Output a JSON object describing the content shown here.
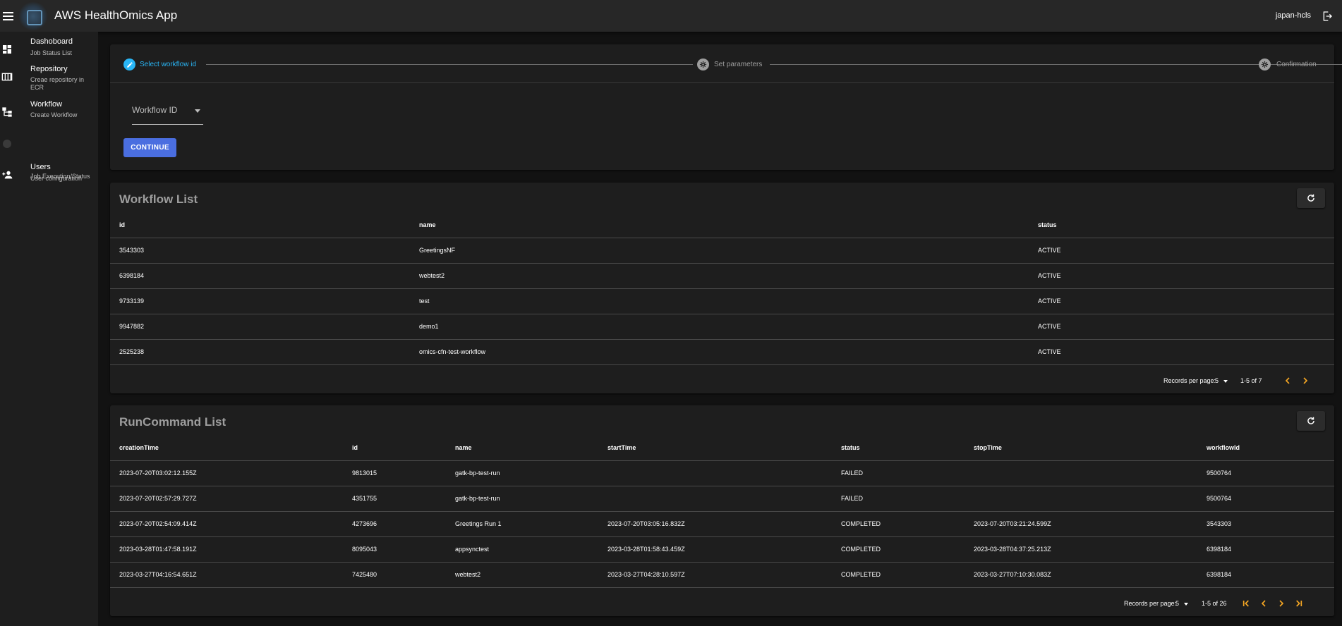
{
  "header": {
    "title": "AWS HealthOmics App",
    "user": "japan-hcls"
  },
  "sidebar": {
    "items": [
      {
        "title": "Dashoboard",
        "subtitle": "Job Status List"
      },
      {
        "title": "Repository",
        "subtitle": "Creae repository in ECR"
      },
      {
        "title": "Workflow",
        "subtitle": "Create Workflow"
      },
      {
        "title": "",
        "subtitle": "Job Execution/Status"
      },
      {
        "title": "Users",
        "subtitle": "User configuration"
      }
    ]
  },
  "stepper": {
    "steps": [
      {
        "label": "Select workflow id",
        "active": true
      },
      {
        "label": "Set parameters",
        "active": false
      },
      {
        "label": "Confirmation",
        "active": false
      }
    ],
    "active_color": "#29b6f6",
    "workflow_select_label": "Workflow ID",
    "continue_label": "CONTINUE"
  },
  "workflow_list": {
    "title": "Workflow List",
    "columns": [
      "id",
      "name",
      "status"
    ],
    "rows": [
      [
        "3543303",
        "GreetingsNF",
        "ACTIVE"
      ],
      [
        "6398184",
        "webtest2",
        "ACTIVE"
      ],
      [
        "9733139",
        "test",
        "ACTIVE"
      ],
      [
        "9947882",
        "demo1",
        "ACTIVE"
      ],
      [
        "2525238",
        "omics-cfn-test-workflow",
        "ACTIVE"
      ]
    ],
    "pagination": {
      "records_label": "Records per page:",
      "per_page": "5",
      "range": "1-5 of 7"
    }
  },
  "run_list": {
    "title": "RunCommand List",
    "columns": [
      "creationTime",
      "id",
      "name",
      "startTime",
      "status",
      "stopTime",
      "workflowId"
    ],
    "rows": [
      [
        "2023-07-20T03:02:12.155Z",
        "9813015",
        "gatk-bp-test-run",
        "",
        "FAILED",
        "",
        "9500764"
      ],
      [
        "2023-07-20T02:57:29.727Z",
        "4351755",
        "gatk-bp-test-run",
        "",
        "FAILED",
        "",
        "9500764"
      ],
      [
        "2023-07-20T02:54:09.414Z",
        "4273696",
        "Greetings Run 1",
        "2023-07-20T03:05:16.832Z",
        "COMPLETED",
        "2023-07-20T03:21:24.599Z",
        "3543303"
      ],
      [
        "2023-03-28T01:47:58.191Z",
        "8095043",
        "appsynctest",
        "2023-03-28T01:58:43.459Z",
        "COMPLETED",
        "2023-03-28T04:37:25.213Z",
        "6398184"
      ],
      [
        "2023-03-27T04:16:54.651Z",
        "7425480",
        "webtest2",
        "2023-03-27T04:28:10.597Z",
        "COMPLETED",
        "2023-03-27T07:10:30.083Z",
        "6398184"
      ]
    ],
    "pagination": {
      "records_label": "Records per page:",
      "per_page": "5",
      "range": "1-5 of 26"
    }
  },
  "colors": {
    "accent": "#4a6ee0",
    "pager_arrow": "#f5a623"
  }
}
